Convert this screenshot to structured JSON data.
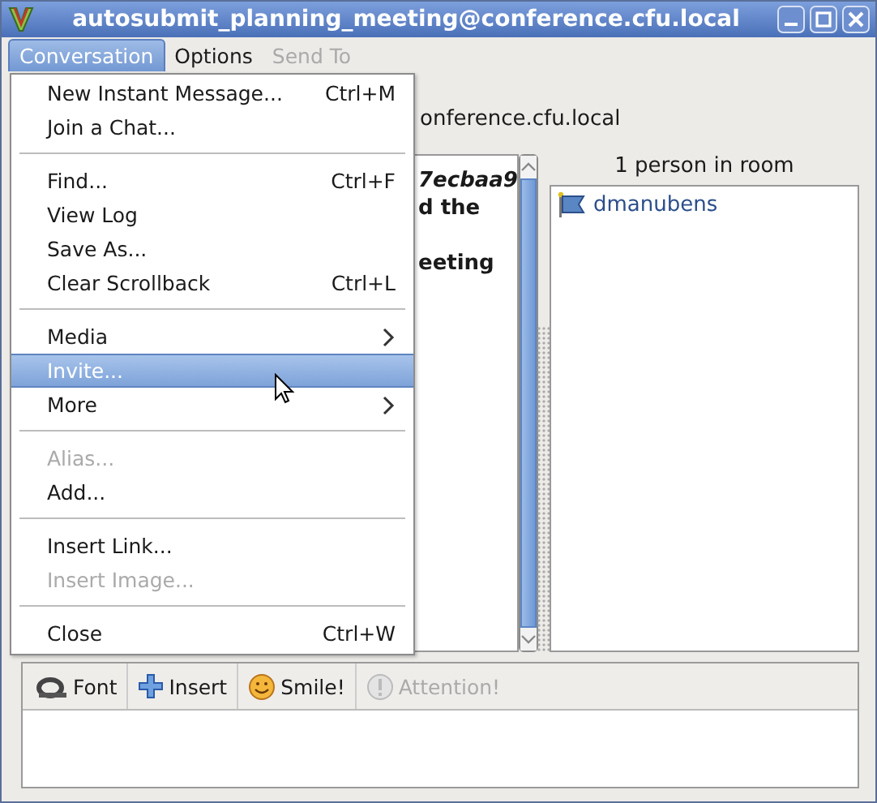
{
  "window": {
    "title": "autosubmit_planning_meeting@conference.cfu.local"
  },
  "menubar": [
    {
      "label": "Conversation",
      "selected": true,
      "disabled": false
    },
    {
      "label": "Options",
      "selected": false,
      "disabled": false
    },
    {
      "label": "Send To",
      "selected": false,
      "disabled": true
    }
  ],
  "menu": [
    {
      "kind": "item",
      "label": "New Instant Message...",
      "shortcut": "Ctrl+M",
      "disabled": false,
      "selected": false
    },
    {
      "kind": "item",
      "label": "Join a Chat...",
      "disabled": false,
      "selected": false
    },
    {
      "kind": "separator"
    },
    {
      "kind": "item",
      "label": "Find...",
      "shortcut": "Ctrl+F",
      "disabled": false,
      "selected": false
    },
    {
      "kind": "item",
      "label": "View Log",
      "disabled": false,
      "selected": false
    },
    {
      "kind": "item",
      "label": "Save As...",
      "disabled": false,
      "selected": false
    },
    {
      "kind": "item",
      "label": "Clear Scrollback",
      "shortcut": "Ctrl+L",
      "disabled": false,
      "selected": false
    },
    {
      "kind": "separator"
    },
    {
      "kind": "submenu",
      "label": "Media",
      "disabled": false,
      "selected": false
    },
    {
      "kind": "item",
      "label": "Invite...",
      "disabled": false,
      "selected": true
    },
    {
      "kind": "submenu",
      "label": "More",
      "disabled": false,
      "selected": false
    },
    {
      "kind": "separator"
    },
    {
      "kind": "item",
      "label": "Alias...",
      "disabled": true,
      "selected": false
    },
    {
      "kind": "item",
      "label": "Add...",
      "disabled": false,
      "selected": false
    },
    {
      "kind": "separator"
    },
    {
      "kind": "item",
      "label": "Insert Link...",
      "disabled": false,
      "selected": false
    },
    {
      "kind": "item",
      "label": "Insert Image...",
      "disabled": true,
      "selected": false
    },
    {
      "kind": "separator"
    },
    {
      "kind": "item",
      "label": "Close",
      "shortcut": "Ctrl+W",
      "disabled": false,
      "selected": false
    }
  ],
  "topic": "onference.cfu.local",
  "chat_lines": [
    {
      "text": "7ecbaa9",
      "italic": true
    },
    {
      "text": "d the",
      "italic": false
    },
    {
      "text": "eeting",
      "italic": false
    }
  ],
  "room": {
    "count": "1 person in room",
    "members": [
      {
        "name": "dmanubens"
      }
    ]
  },
  "toolbar": [
    {
      "kind": "font",
      "label": "Font",
      "disabled": false
    },
    {
      "kind": "insert",
      "label": "Insert",
      "disabled": false
    },
    {
      "kind": "smile",
      "label": "Smile!",
      "disabled": false
    },
    {
      "kind": "attention",
      "label": "Attention!",
      "disabled": true
    }
  ]
}
